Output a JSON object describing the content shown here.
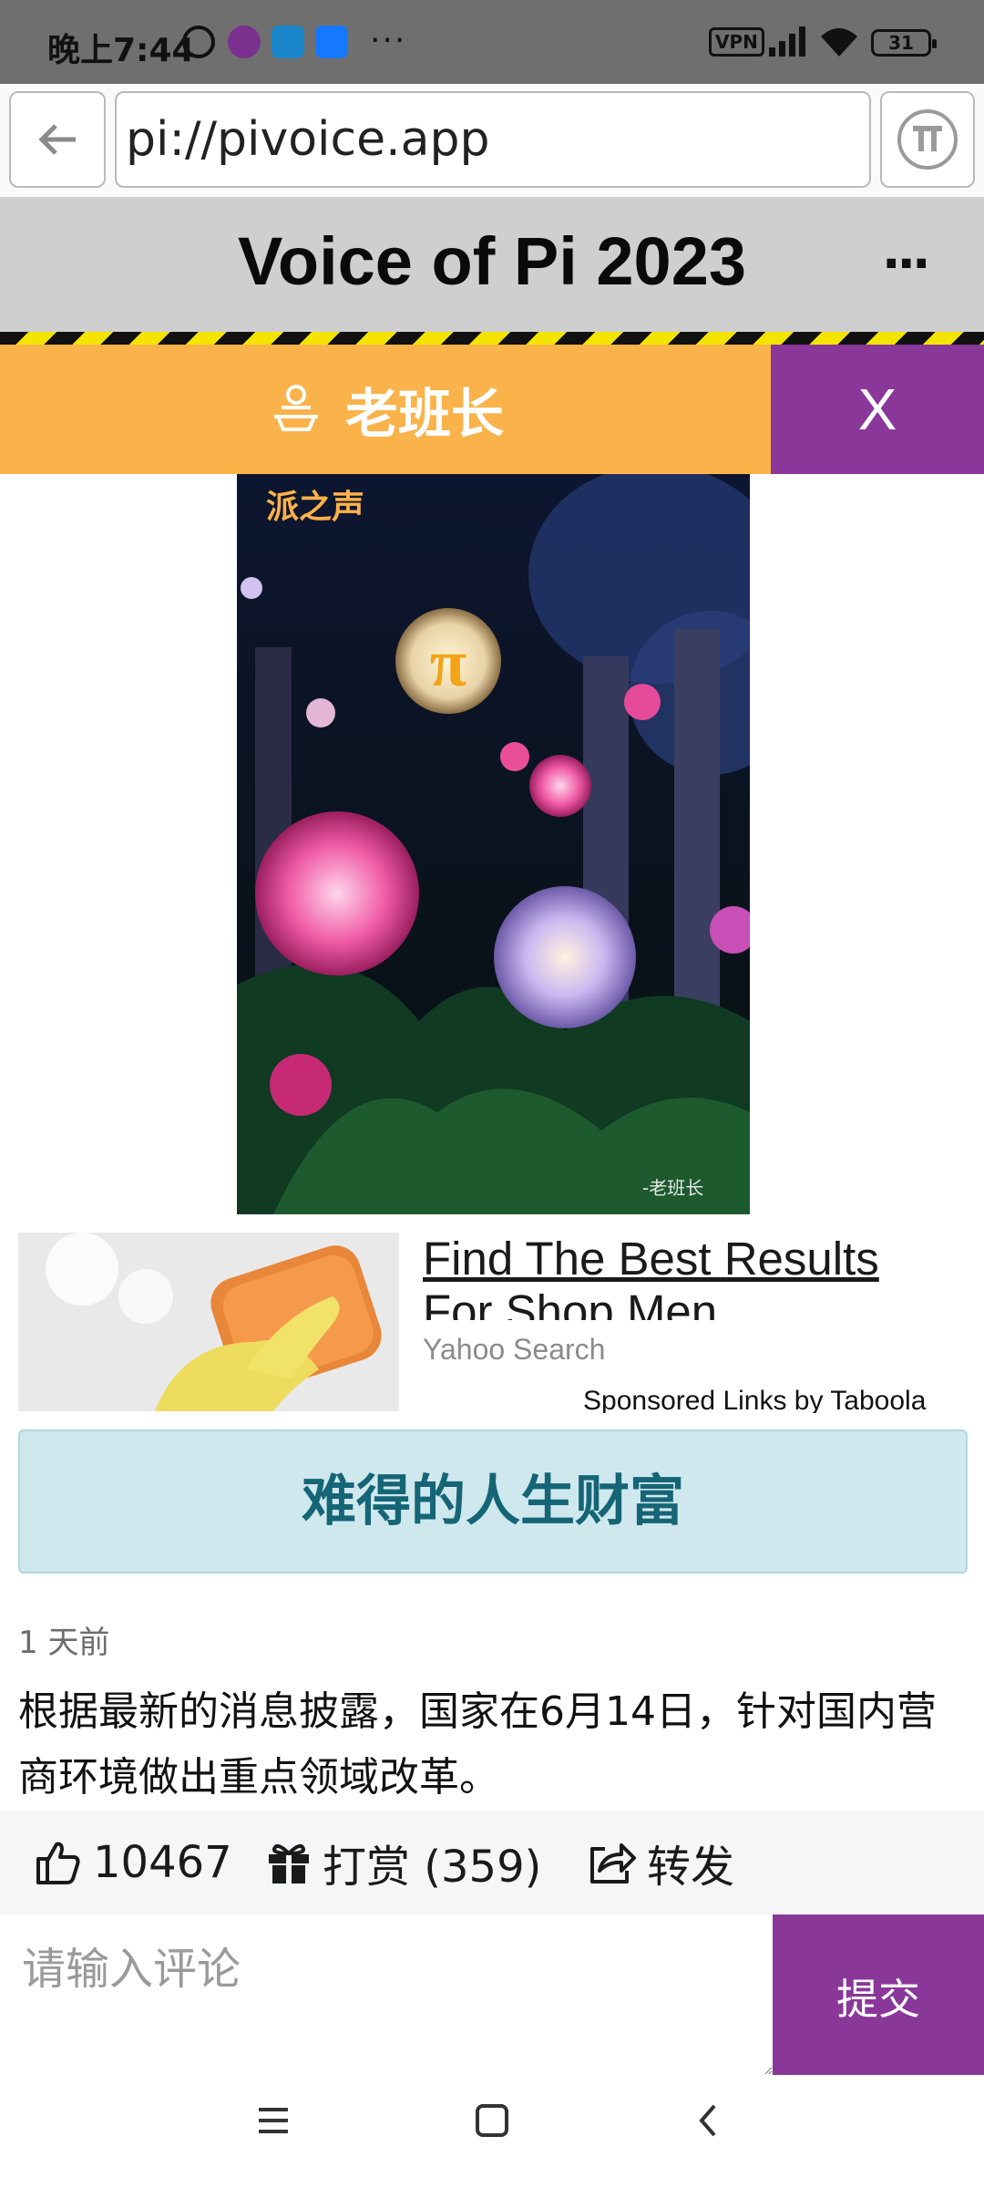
{
  "status_bar": {
    "time": "晚上7:44",
    "more": "···",
    "vpn": "VPN",
    "battery": "31"
  },
  "browser": {
    "url": "pi://pivoice.app"
  },
  "header": {
    "title": "Voice of Pi 2023",
    "more": "···"
  },
  "author": {
    "name": "老班长",
    "close_label": "X"
  },
  "hero_image": {
    "overlay_text": "派之声",
    "signature": "-老班长"
  },
  "ad": {
    "title": "Find The Best Results For Shop Men",
    "source": "Yahoo Search",
    "sponsor": "Sponsored Links by Taboola"
  },
  "article": {
    "headline": "难得的人生财富",
    "time_ago": "1 天前",
    "body": "根据最新的消息披露，国家在6月14日，针对国内营商环境做出重点领域改革。"
  },
  "actions": {
    "like_count": "10467",
    "reward_label": "打赏 (359)",
    "share_label": "转发"
  },
  "comment": {
    "placeholder": "请输入评论",
    "submit_label": "提交"
  },
  "colors": {
    "author_bar": "#f9b34a",
    "accent_purple": "#8a379a",
    "headline_bg": "#cfe8ee",
    "headline_text": "#156576"
  }
}
